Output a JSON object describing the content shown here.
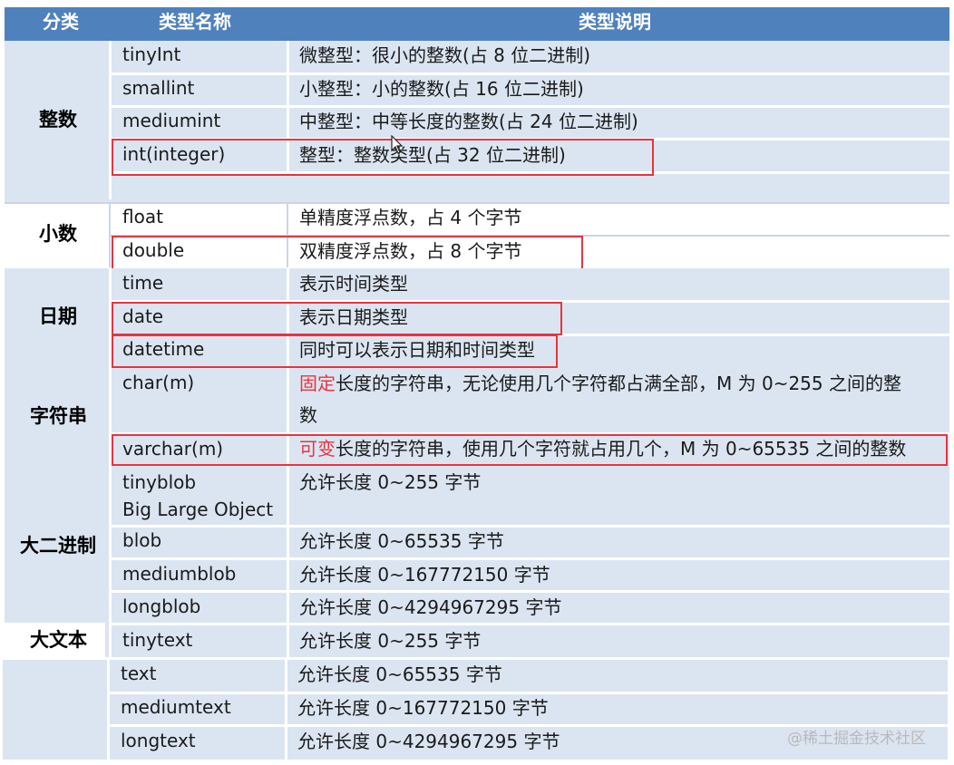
{
  "header": {
    "col_category": "分类",
    "col_type_name": "类型名称",
    "col_description": "类型说明"
  },
  "groups": [
    {
      "category": "整数",
      "rows": [
        {
          "name": "tinyInt",
          "desc": "微整型：很小的整数(占 8 位二进制)"
        },
        {
          "name": "smallint",
          "desc": "小整型：小的整数(占 16 位二进制)"
        },
        {
          "name": "mediumint",
          "desc": "中整型：中等长度的整数(占 24 位二进制)"
        },
        {
          "name": "int(integer)",
          "desc": "整型：整数类型(占 32 位二进制)",
          "highlighted": true
        }
      ]
    },
    {
      "category": "小数",
      "rows": [
        {
          "name": "float",
          "desc": "单精度浮点数，占 4 个字节"
        },
        {
          "name": "double",
          "desc": "双精度浮点数，占 8 个字节",
          "highlighted": true
        }
      ]
    },
    {
      "category": "日期",
      "rows": [
        {
          "name": "time",
          "desc": "表示时间类型"
        },
        {
          "name": "date",
          "desc": "表示日期类型",
          "highlighted": true
        },
        {
          "name": "datetime",
          "desc": "同时可以表示日期和时间类型",
          "highlighted": true
        }
      ]
    },
    {
      "category": "字符串",
      "rows": [
        {
          "name": "char(m)",
          "desc_emph": "固定",
          "desc_rest_line1": "长度的字符串，无论使用几个字符都占满全部，M 为 0~255 之间的整",
          "desc_rest_line2": "数"
        },
        {
          "name": "varchar(m)",
          "desc_emph": "可变",
          "desc_rest": "长度的字符串，使用几个字符就占用几个，M 为 0~65535 之间的整数",
          "highlighted": true
        }
      ]
    },
    {
      "category": "大二进制",
      "rows": [
        {
          "name": "tinyblob",
          "name_line2": "Big Large Object",
          "desc": "允许长度 0~255 字节"
        },
        {
          "name": "blob",
          "desc": "允许长度 0~65535 字节"
        },
        {
          "name": "mediumblob",
          "desc": "允许长度 0~167772150 字节"
        },
        {
          "name": "longblob",
          "desc": "允许长度 0~4294967295 字节"
        }
      ]
    },
    {
      "category": "大文本",
      "rows": [
        {
          "name": "tinytext",
          "desc": "允许长度 0~255 字节"
        },
        {
          "name": "text",
          "desc": "允许长度 0~65535 字节"
        },
        {
          "name": "mediumtext",
          "desc": "允许长度 0~167772150 字节"
        },
        {
          "name": "longtext",
          "desc": "允许长度 0~4294967295 字节"
        }
      ]
    }
  ],
  "watermark": "@稀土掘金技术社区",
  "colors": {
    "header_bg": "#4f81bd",
    "band_bg": "#dbe5f1",
    "highlight_border": "#e8343f",
    "emphasis_text": "#e8343f"
  }
}
